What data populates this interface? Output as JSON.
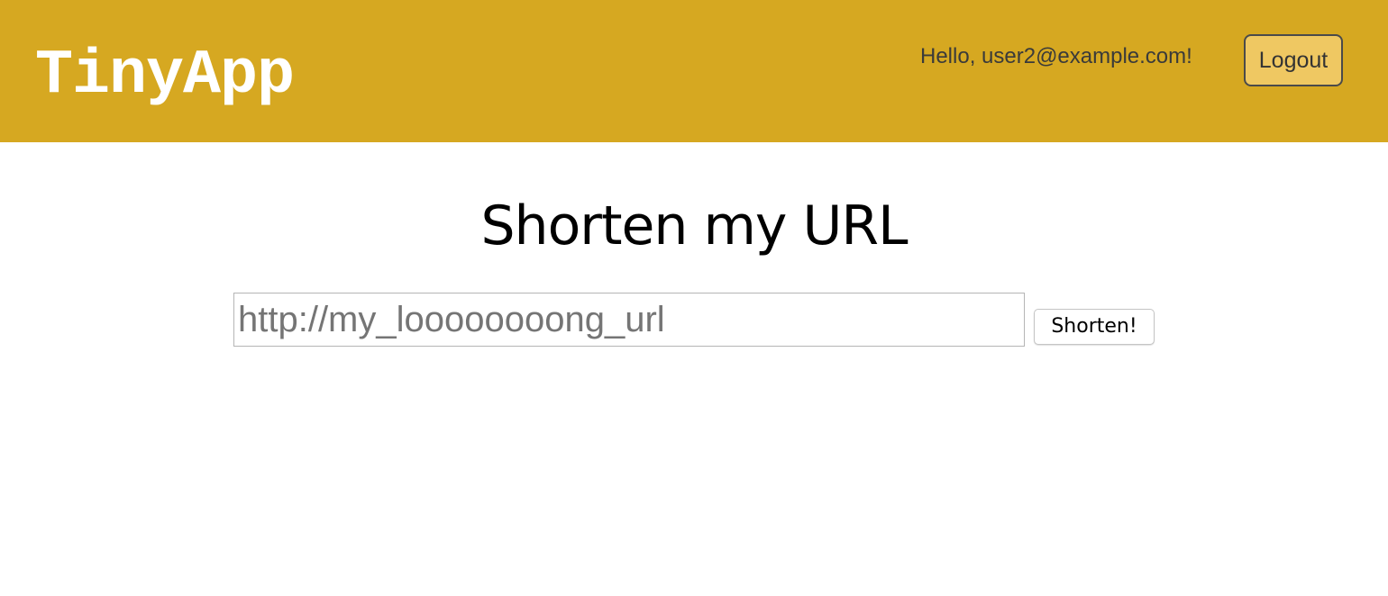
{
  "header": {
    "brand": "TinyApp",
    "greeting": "Hello, user2@example.com!",
    "logout_label": "Logout",
    "background_color": "#d6a821",
    "logout_button_color": "#efc862"
  },
  "main": {
    "title": "Shorten my URL",
    "url_input": {
      "value": "",
      "placeholder": "http://my_loooooooong_url"
    },
    "submit_label": "Shorten!"
  }
}
